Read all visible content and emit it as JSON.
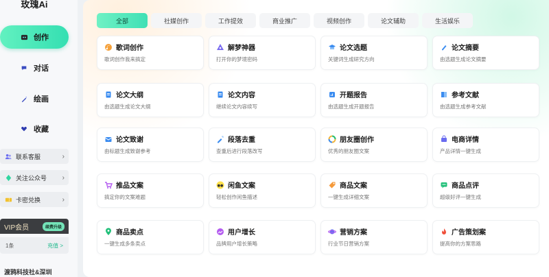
{
  "app": {
    "brand": "玫瑰Ai"
  },
  "sidebar": {
    "nav": [
      {
        "label": "创作",
        "active": true
      },
      {
        "label": "对话"
      },
      {
        "label": "绘画"
      },
      {
        "label": "收藏"
      }
    ],
    "links": [
      {
        "label": "联系客服"
      },
      {
        "label": "关注公众号"
      },
      {
        "label": "卡密兑换"
      }
    ],
    "vip": {
      "title": "VIP会员",
      "button": "续费升级",
      "count": "1条",
      "renew": "充值 >"
    },
    "company": "渡鸦科技社&深圳"
  },
  "tabs": [
    {
      "label": "全部",
      "active": true
    },
    {
      "label": "社媒创作"
    },
    {
      "label": "工作提效"
    },
    {
      "label": "商业推广"
    },
    {
      "label": "视频创作"
    },
    {
      "label": "论文辅助"
    },
    {
      "label": "生活娱乐"
    }
  ],
  "cards": [
    {
      "title": "歌词创作",
      "desc": "歌词创作我来搞定",
      "icon": "music-icon",
      "color": "#f5a13b"
    },
    {
      "title": "解梦神器",
      "desc": "打开你的梦境密码",
      "icon": "dream-icon",
      "color": "#7a6cf0"
    },
    {
      "title": "论文选题",
      "desc": "关键词生成研究方向",
      "icon": "graduation-icon",
      "color": "#3b8cf0"
    },
    {
      "title": "论文摘要",
      "desc": "由选题生成论文摘要",
      "icon": "pen-icon",
      "color": "#3b8cf0"
    },
    {
      "title": "论文大纲",
      "desc": "由选题生成论文大纲",
      "icon": "document-icon",
      "color": "#3b8cf0"
    },
    {
      "title": "论文内容",
      "desc": "继续论文内容续写",
      "icon": "document-icon",
      "color": "#3b8cf0"
    },
    {
      "title": "开题报告",
      "desc": "由选题生成开题报告",
      "icon": "report-icon",
      "color": "#3b8cf0"
    },
    {
      "title": "参考文献",
      "desc": "由选题生成参考文献",
      "icon": "book-icon",
      "color": "#3b8cf0"
    },
    {
      "title": "论文致谢",
      "desc": "由标题生成致谢参考",
      "icon": "thanks-icon",
      "color": "#3b8cf0"
    },
    {
      "title": "段落去重",
      "desc": "查重后进行段落改写",
      "icon": "rewrite-icon",
      "color": "#3b8cf0"
    },
    {
      "title": "朋友圈创作",
      "desc": "优秀的朋友圈文案",
      "icon": "moments-icon",
      "color": "#f0b43b"
    },
    {
      "title": "电商详情",
      "desc": "产品详情一键生成",
      "icon": "shop-icon",
      "color": "#6a6cf0"
    },
    {
      "title": "推品文案",
      "desc": "搞定你的文案难题",
      "icon": "cart-icon",
      "color": "#b45cf0"
    },
    {
      "title": "闲鱼文案",
      "desc": "轻松创作闲鱼描述",
      "icon": "xianyu-icon",
      "color": "#f7d21b"
    },
    {
      "title": "商品文案",
      "desc": "一键生成详细文案",
      "icon": "tag-icon",
      "color": "#f59a3b"
    },
    {
      "title": "商品点评",
      "desc": "超级好评一键生成",
      "icon": "comment-icon",
      "color": "#22c07a"
    },
    {
      "title": "商品卖点",
      "desc": "一键生成多条卖点",
      "icon": "location-icon",
      "color": "#22c07a"
    },
    {
      "title": "用户增长",
      "desc": "品牌用户增长策略",
      "icon": "growth-icon",
      "color": "#b45cf0"
    },
    {
      "title": "营销方案",
      "desc": "行业节日营销方案",
      "icon": "planet-icon",
      "color": "#6a6cf0"
    },
    {
      "title": "广告策划案",
      "desc": "提高你的方案思路",
      "icon": "flame-icon",
      "color": "#f0503b"
    }
  ]
}
